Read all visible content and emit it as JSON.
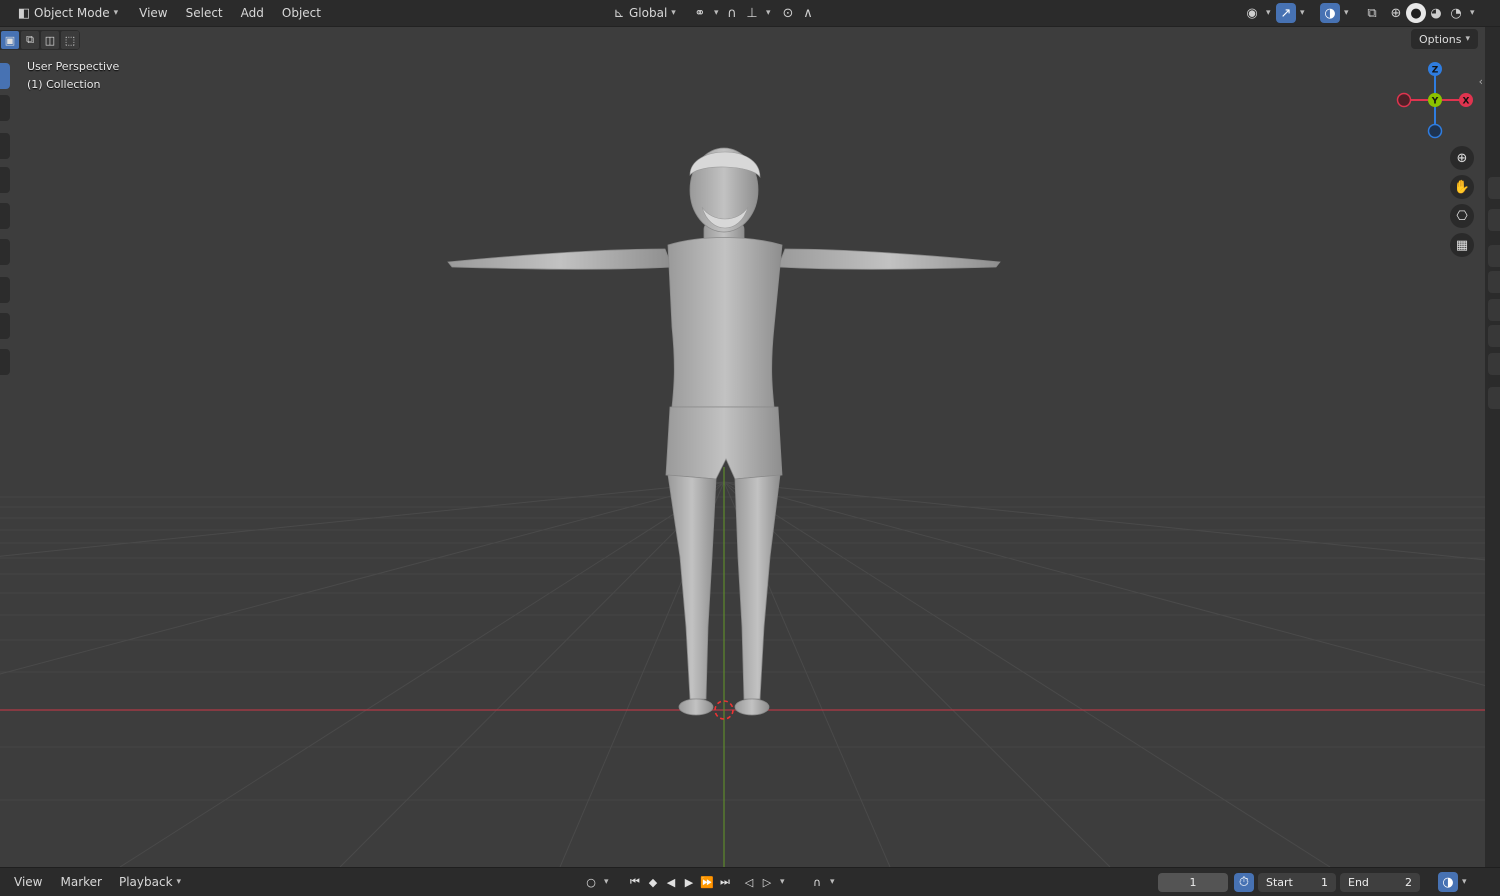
{
  "header": {
    "mode_label": "Object Mode",
    "menus": [
      "View",
      "Select",
      "Add",
      "Object"
    ],
    "transform_orientation": "Global"
  },
  "viewport": {
    "perspective_label": "User Perspective",
    "collection_label": "(1) Collection",
    "options_label": "Options",
    "gizmo": {
      "z": "Z",
      "y": "Y",
      "x": "X"
    }
  },
  "timeline": {
    "menus": [
      "View",
      "Marker",
      "Playback"
    ],
    "current_frame": "1",
    "start_label": "Start",
    "start_value": "1",
    "end_label": "End",
    "end_value": "2"
  },
  "colors": {
    "accent": "#4772b3",
    "axis_x": "#e0344f",
    "axis_y": "#8bc200",
    "axis_z": "#2f7de0",
    "viewport_bg": "#3d3d3d"
  }
}
